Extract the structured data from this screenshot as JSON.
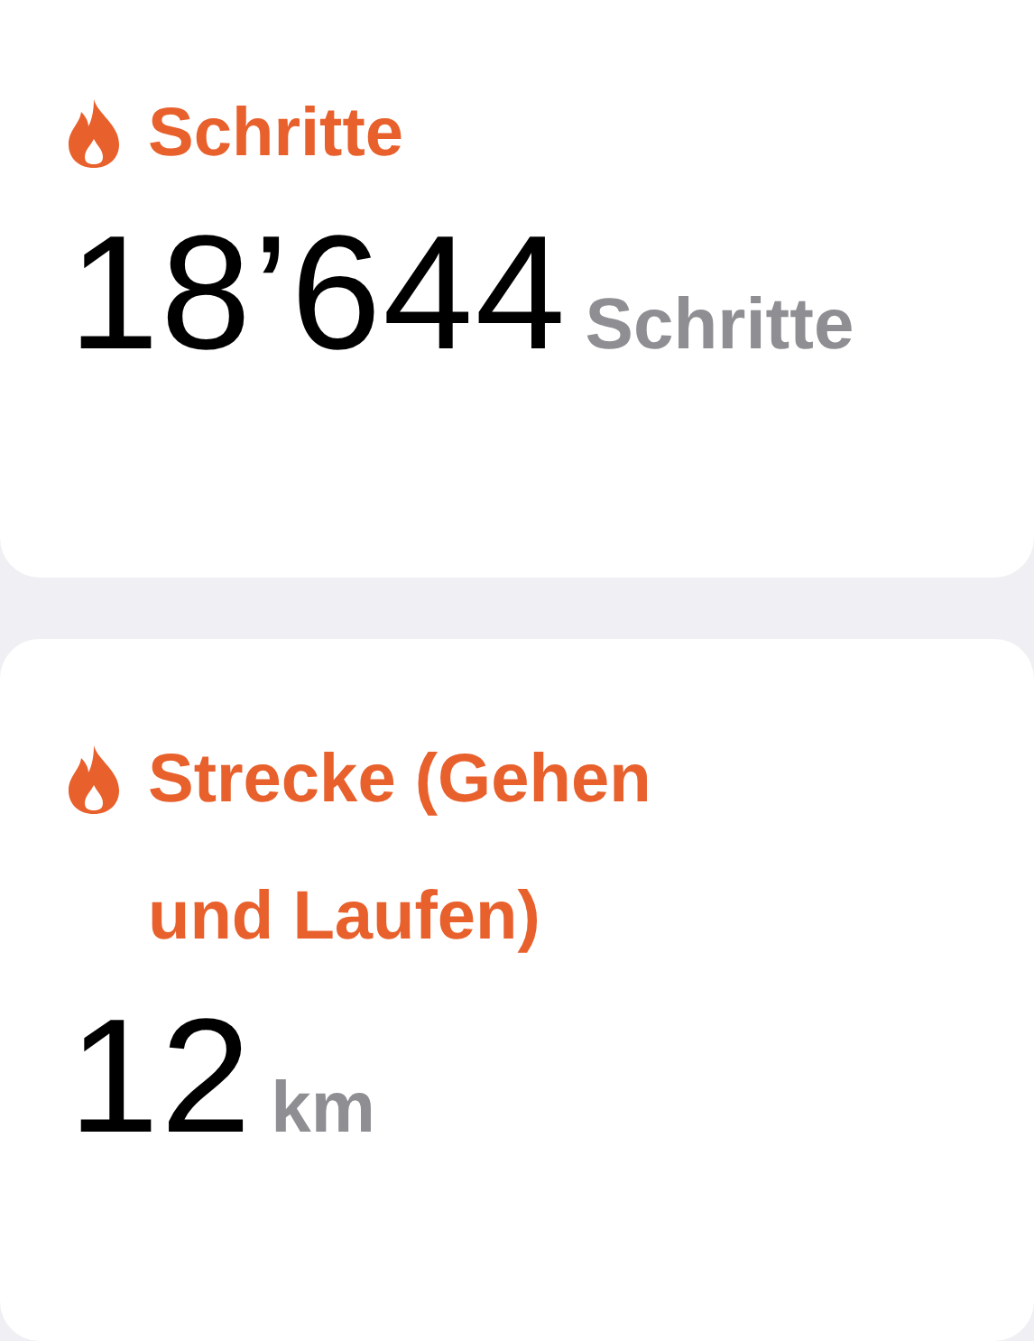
{
  "cards": [
    {
      "title": "Schritte",
      "value": "18’644",
      "unit": "Schritte"
    },
    {
      "title": "Strecke (Gehen und Laufen)",
      "value": "12",
      "unit": "km"
    }
  ]
}
